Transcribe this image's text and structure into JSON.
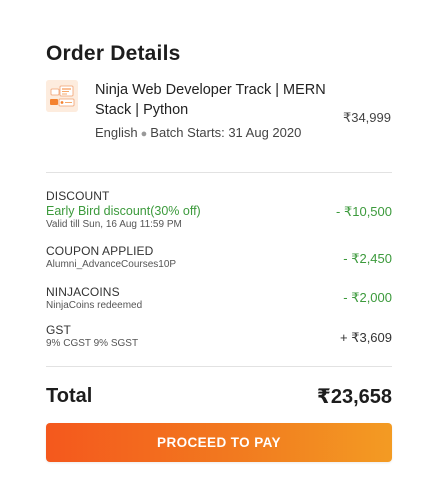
{
  "header": {
    "title": "Order Details"
  },
  "course": {
    "icon": "course-thumbnail-icon",
    "name": "Ninja Web Developer Track | MERN Stack | Python",
    "language": "English",
    "batch": "Batch Starts: 31 Aug 2020",
    "price": "₹34,999"
  },
  "discounts": {
    "discount": {
      "label": "DISCOUNT",
      "name": "Early Bird discount(30% off)",
      "note": "Valid till Sun, 16 Aug 11:59 PM",
      "amount": "- ₹10,500"
    },
    "coupon": {
      "label": "COUPON APPLIED",
      "note": "Alumni_AdvanceCourses10P",
      "amount": "- ₹2,450"
    },
    "ninjacoins": {
      "label": "NINJACOINS",
      "note": "NinjaCoins redeemed",
      "amount": "- ₹2,000"
    },
    "gst": {
      "label": "GST",
      "note": "9% CGST 9% SGST",
      "amount": "+ ₹3,609"
    }
  },
  "total": {
    "label": "Total",
    "value": "₹23,658"
  },
  "actions": {
    "pay_label": "PROCEED TO PAY"
  },
  "colors": {
    "accent_start": "#f4581d",
    "accent_end": "#f39b23",
    "discount_green": "#3c9a3c"
  }
}
